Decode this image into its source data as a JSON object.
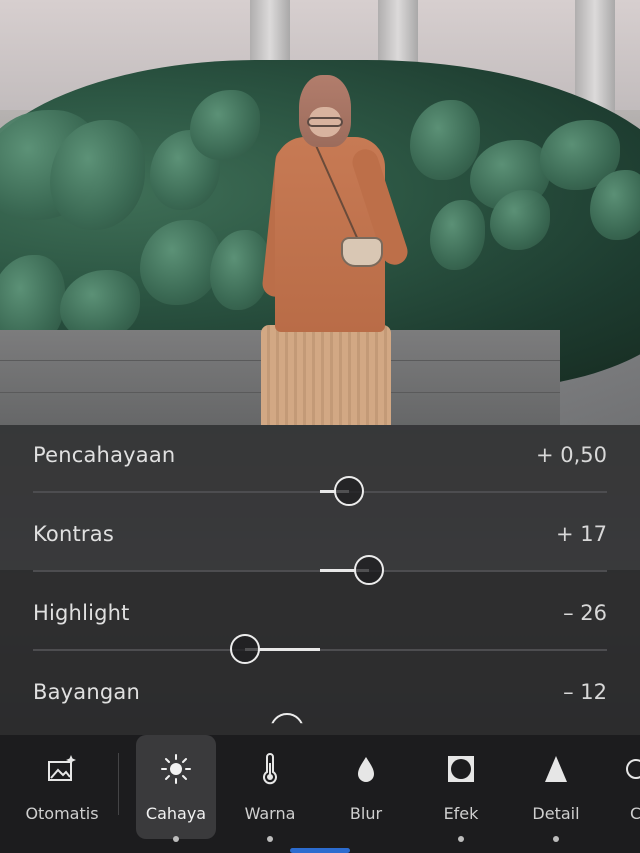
{
  "adjustments": [
    {
      "label": "Pencahayaan",
      "value": "+ 0,50",
      "position": 0.55
    },
    {
      "label": "Kontras",
      "value": "+ 17",
      "position": 0.585
    },
    {
      "label": "Highlight",
      "value": "– 26",
      "position": 0.37
    },
    {
      "label": "Bayangan",
      "value": "– 12"
    }
  ],
  "tools": [
    {
      "label": "Otomatis",
      "icon": "auto-enhance-icon"
    },
    {
      "label": "Cahaya",
      "icon": "sun-icon",
      "active": true
    },
    {
      "label": "Warna",
      "icon": "thermometer-icon"
    },
    {
      "label": "Blur",
      "icon": "drop-icon"
    },
    {
      "label": "Efek",
      "icon": "vignette-icon"
    },
    {
      "label": "Detail",
      "icon": "triangle-icon"
    }
  ],
  "colors": {
    "accent": "#2c6ccf",
    "panel": "#1f1f21",
    "slider": "#ececec"
  }
}
